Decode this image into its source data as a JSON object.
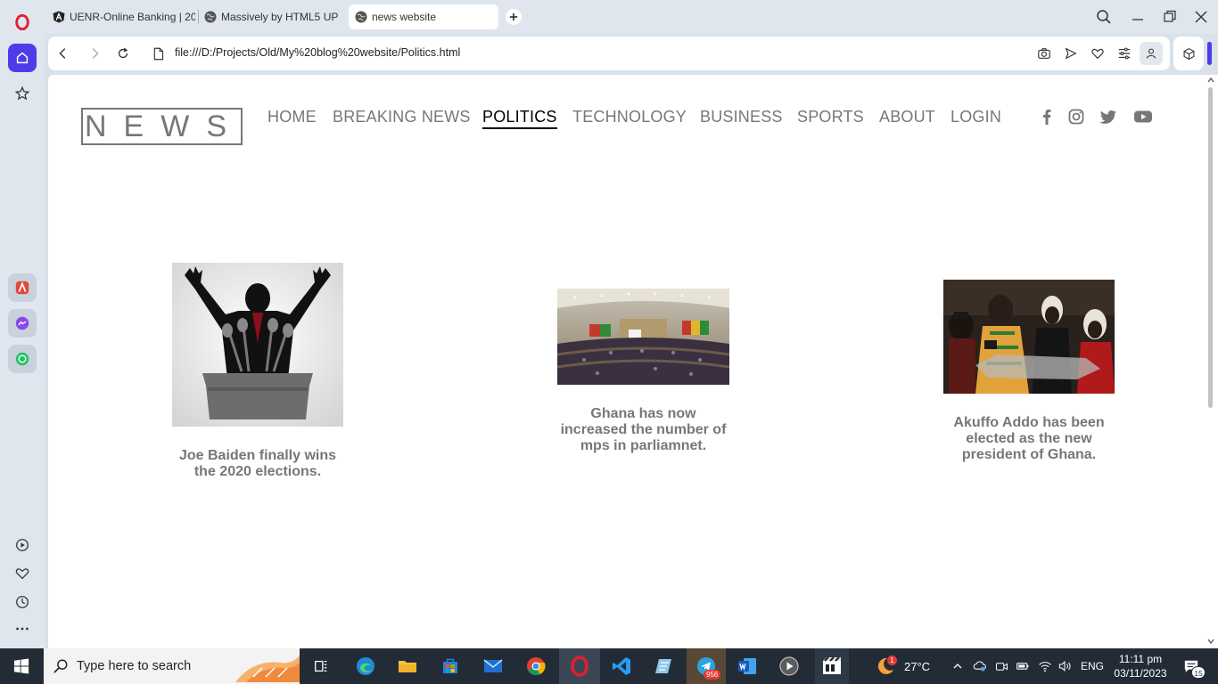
{
  "browser": {
    "tabs": [
      {
        "label": "UENR-Online Banking | 20",
        "icon": "angular-icon"
      },
      {
        "label": "Massively by HTML5 UP",
        "icon": "globe-icon"
      },
      {
        "label": "news website",
        "icon": "globe-icon",
        "active": true
      }
    ],
    "url": "file:///D:/Projects/Old/My%20blog%20website/Politics.html"
  },
  "site": {
    "logo": "NEWS",
    "nav": [
      "HOME",
      "BREAKING NEWS",
      "POLITICS",
      "TECHNOLOGY",
      "BUSINESS",
      "SPORTS",
      "ABOUT",
      "LOGIN"
    ],
    "active_nav": "POLITICS",
    "social": [
      "facebook-icon",
      "instagram-icon",
      "twitter-icon",
      "youtube-icon"
    ],
    "articles": [
      {
        "caption": "Joe Baiden finally wins the 2020 elections."
      },
      {
        "caption": "Ghana has now increased the number of mps in parliamnet."
      },
      {
        "caption": "Akuffo Addo has been elected as the new president of Ghana."
      }
    ]
  },
  "taskbar": {
    "search_placeholder": "Type here to search",
    "weather": "27°C",
    "language": "ENG",
    "time": "11:11 pm",
    "date": "03/11/2023",
    "telegram_badge": "956",
    "notification_count": "15",
    "weather_badge": "1"
  },
  "colors": {
    "accent": "#4f3ce8",
    "nav_text": "#777777",
    "taskbar": "#232c36",
    "opera_red": "#e01f2f"
  }
}
